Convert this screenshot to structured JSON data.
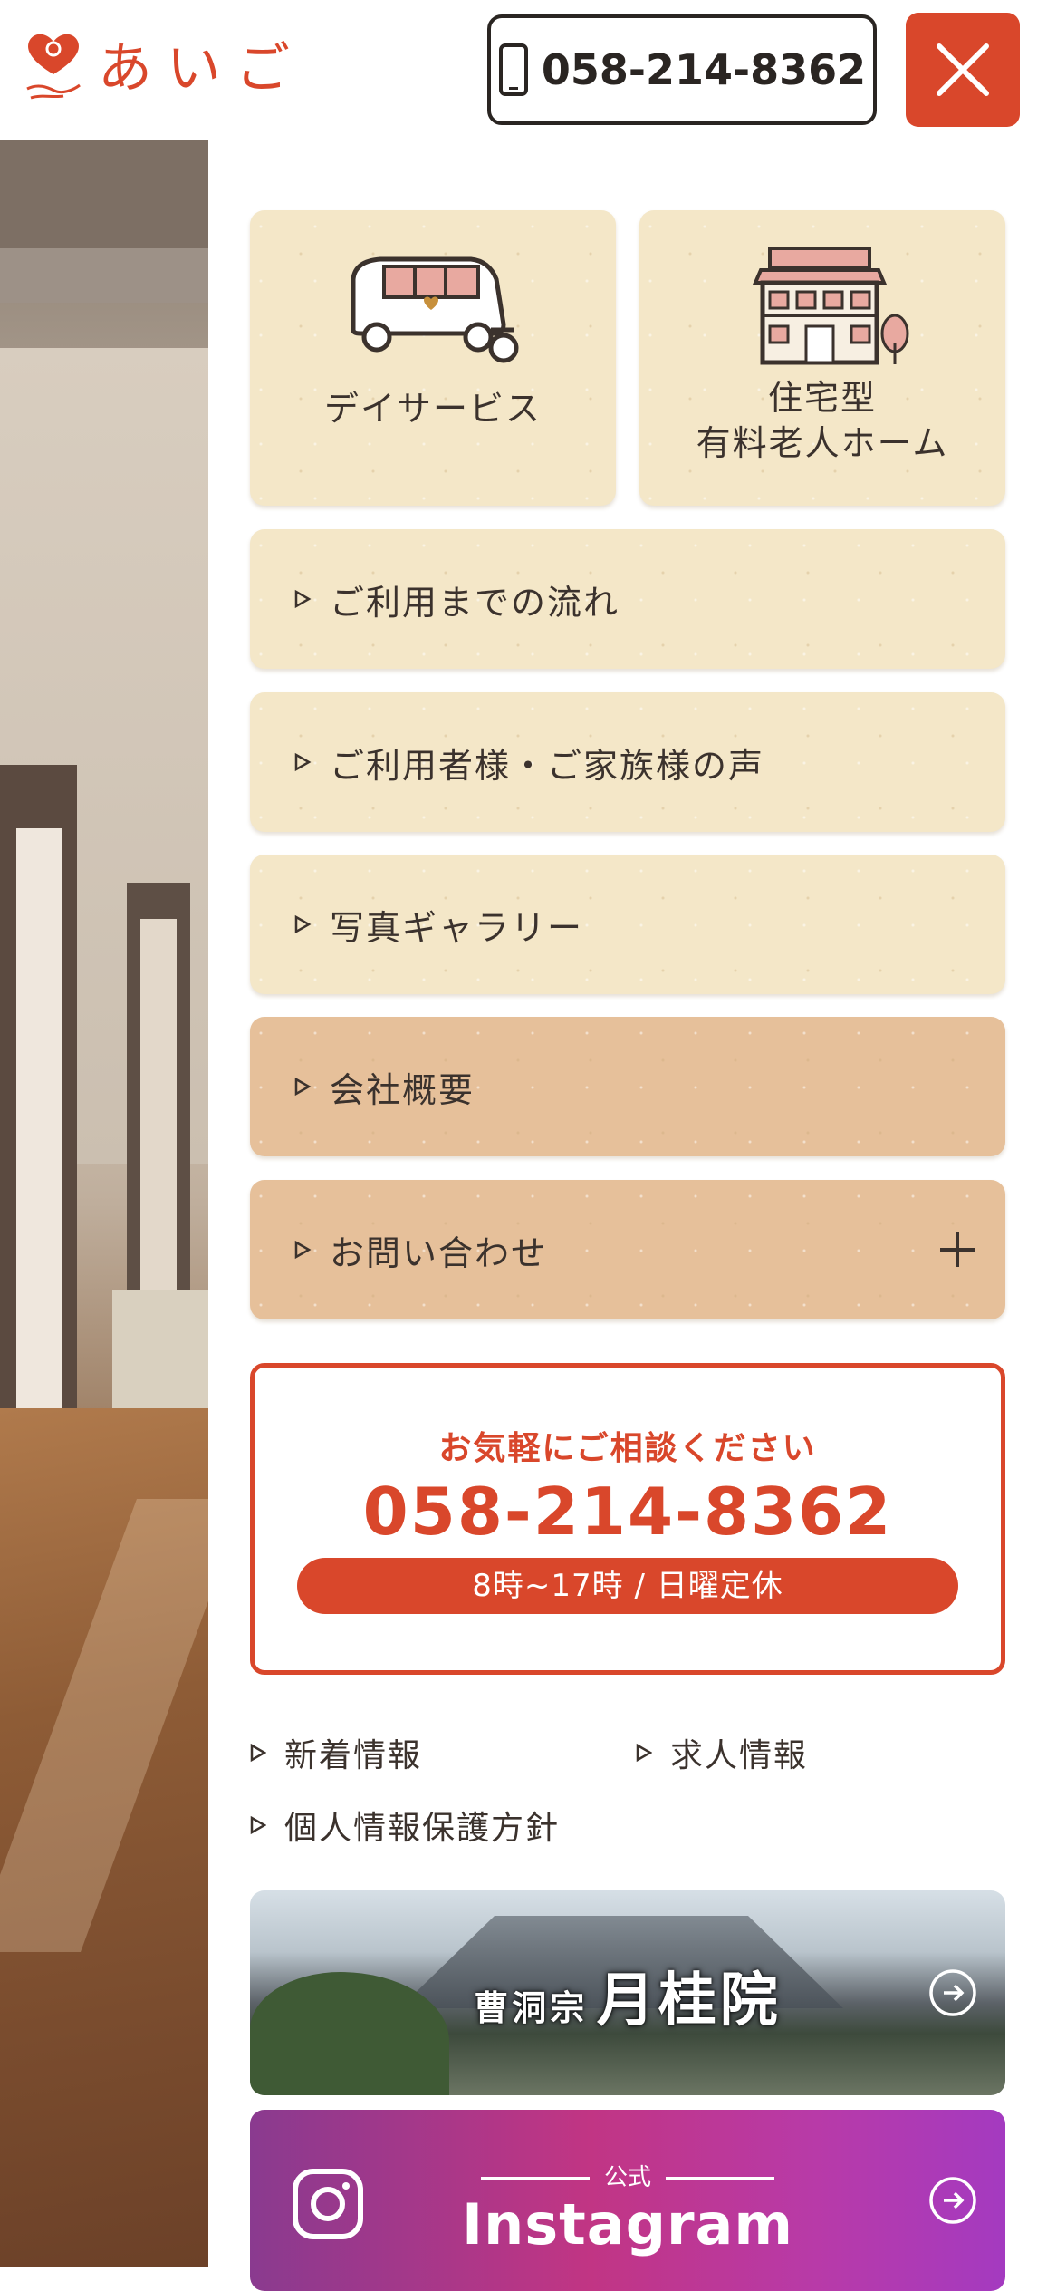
{
  "header": {
    "logo_text": "あいご",
    "phone": "058-214-8362",
    "colors": {
      "accent": "#d9472b",
      "text": "#2a2522"
    }
  },
  "menu": {
    "cards": [
      {
        "label_lines": [
          "デイサービス"
        ],
        "icon": "van-icon"
      },
      {
        "label_lines": [
          "住宅型",
          "有料老人ホーム"
        ],
        "icon": "house-icon"
      }
    ],
    "items": [
      {
        "label": "ご利用までの流れ"
      },
      {
        "label": "ご利用者様・ご家族様の声"
      },
      {
        "label": "写真ギャラリー"
      },
      {
        "label": "会社概要"
      },
      {
        "label": "お問い合わせ"
      }
    ],
    "colors": {
      "card": "#f4e7c8",
      "card_dark": "#e6c09a"
    }
  },
  "contact": {
    "lead": "お気軽にご相談ください",
    "phone": "058-214-8362",
    "hours": "8時~17時 / 日曜定休"
  },
  "links": [
    {
      "label": "新着情報"
    },
    {
      "label": "求人情報"
    },
    {
      "label": "個人情報保護方針"
    }
  ],
  "banners": {
    "temple": {
      "small": "曹洞宗",
      "large": "月桂院"
    },
    "instagram": {
      "sub": "公式",
      "title": "Instagram"
    }
  }
}
